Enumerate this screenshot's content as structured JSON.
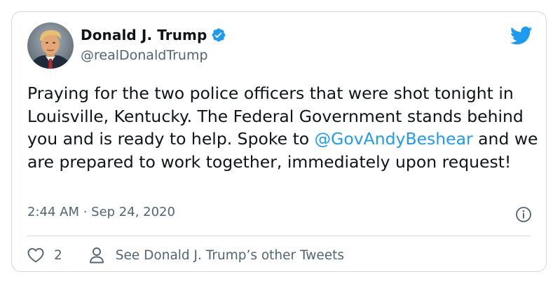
{
  "author": {
    "display_name": "Donald J. Trump",
    "handle": "@realDonaldTrump",
    "verified_icon": "verified-badge-icon",
    "avatar_icon": "profile-photo"
  },
  "brand": {
    "icon": "twitter-bird-icon",
    "color": "#1d9bf0"
  },
  "tweet": {
    "text_part1": "Praying for the two police officers that were shot tonight in Louisville, Kentucky. The Federal Government stands behind you and is ready to help. Spoke to ",
    "mention": "@GovAndyBeshear",
    "text_part2": " and we are prepared to work together, immediately upon request!",
    "timestamp": "2:44 AM · Sep 24, 2020"
  },
  "actions": {
    "like_icon": "heart-icon",
    "like_count": "2",
    "profile_icon": "person-icon",
    "profile_link": "See Donald J. Trump’s other Tweets",
    "info_icon": "info-icon"
  },
  "colors": {
    "text": "#0f1419",
    "secondary": "#536471",
    "link": "#1d9bf0",
    "border": "#cfd9de"
  }
}
